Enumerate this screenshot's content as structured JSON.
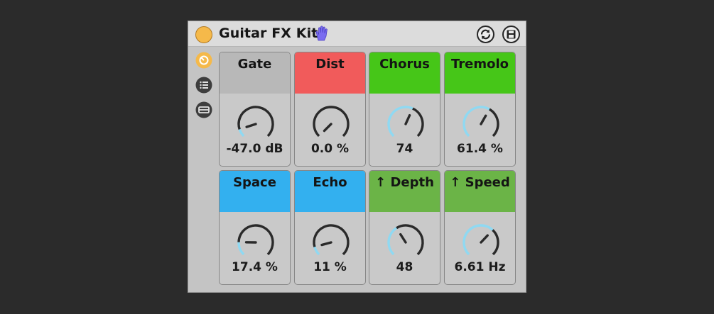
{
  "device": {
    "title": "Guitar FX Kit",
    "title_icon": "hand-icon",
    "power_on": true,
    "buttons": [
      "macro-variations-icon",
      "save-preset-icon"
    ],
    "side_buttons": [
      "macro-controls-icon",
      "list-icon",
      "collapse-icon"
    ]
  },
  "macros": [
    {
      "label": "Gate",
      "value": "-47.0 dB",
      "color": "#b8b8b8",
      "fraction": 0.1
    },
    {
      "label": "Dist",
      "value": "0.0 %",
      "color": "#f15b5b",
      "fraction": 0.0
    },
    {
      "label": "Chorus",
      "value": "74",
      "color": "#46c618",
      "fraction": 0.59
    },
    {
      "label": "Tremolo",
      "value": "61.4 %",
      "color": "#46c618",
      "fraction": 0.61
    },
    {
      "label": "Space",
      "value": "17.4 %",
      "color": "#33b0ef",
      "fraction": 0.17
    },
    {
      "label": "Echo",
      "value": "11 %",
      "color": "#33b0ef",
      "fraction": 0.11
    },
    {
      "label": "↑ Depth",
      "value": "48",
      "color": "#6bb447",
      "fraction": 0.38
    },
    {
      "label": "↑ Speed",
      "value": "6.61 Hz",
      "color": "#6bb447",
      "fraction": 0.66
    }
  ]
}
